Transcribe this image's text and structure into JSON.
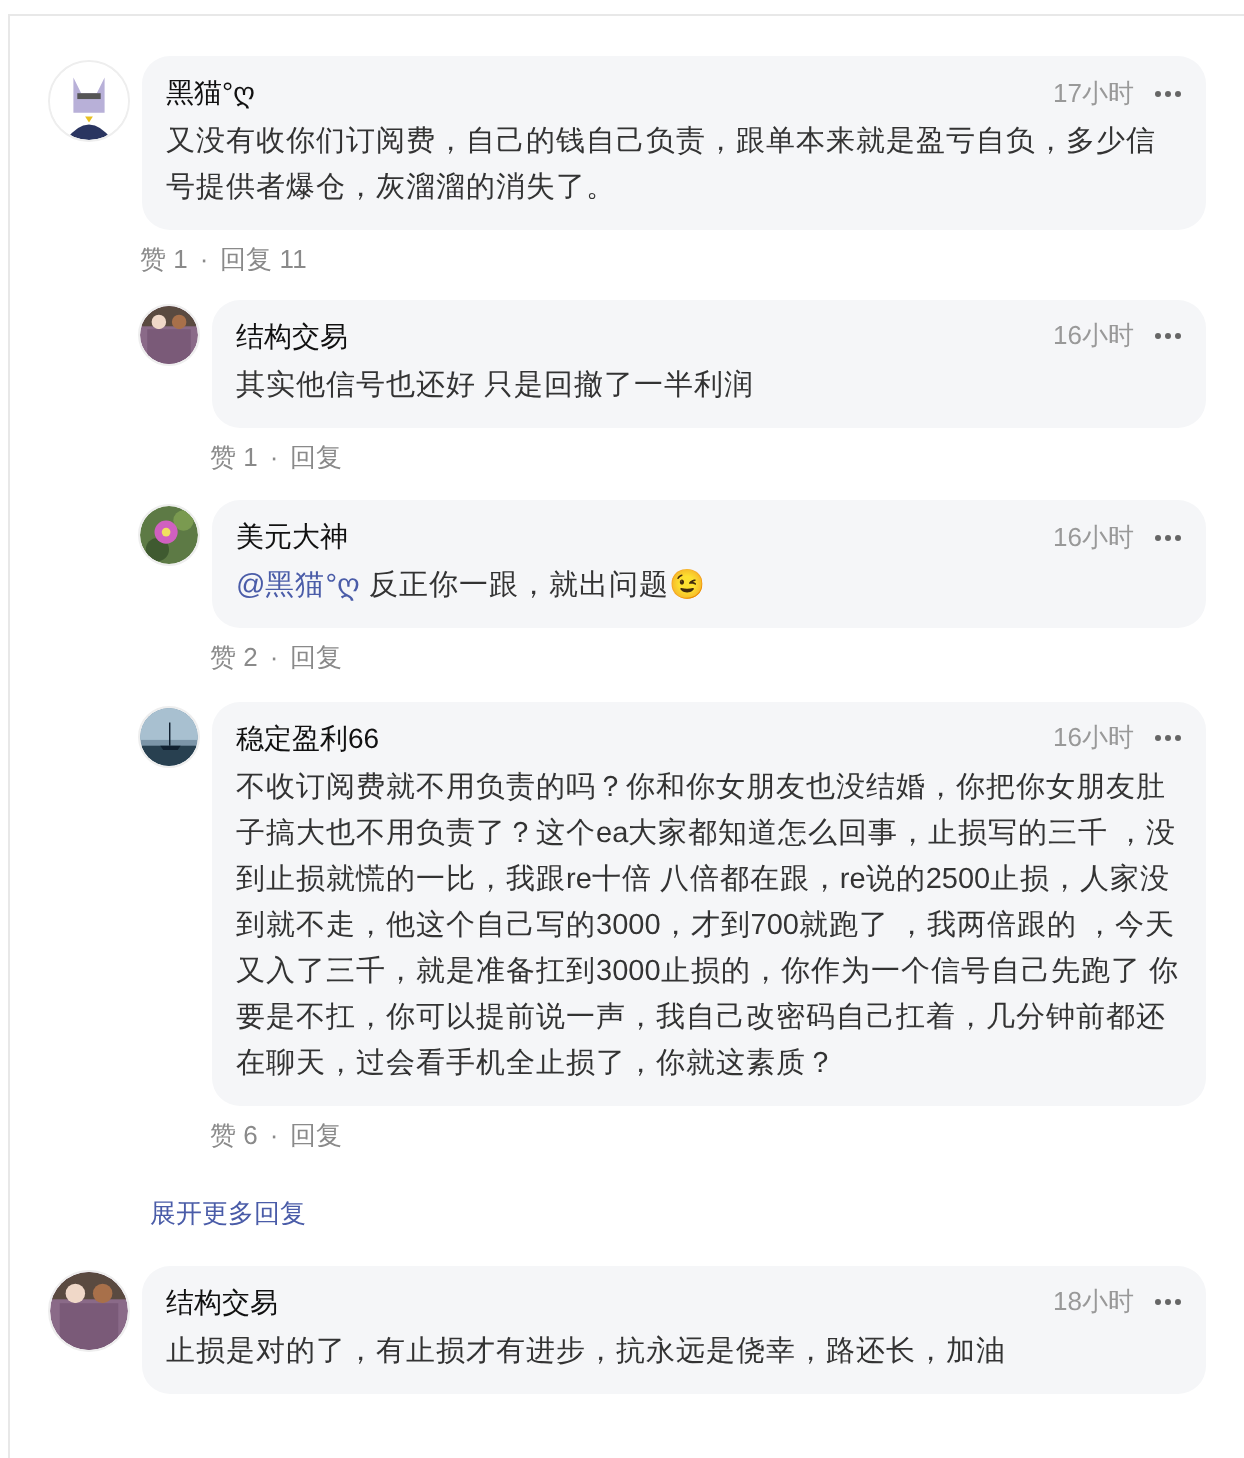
{
  "comments": [
    {
      "author": "黑猫°ღ",
      "time": "17小时",
      "text": "又没有收你们订阅费，自己的钱自己负责，跟单本来就是盈亏自负，多少信号提供者爆仓，灰溜溜的消失了。",
      "likes": "赞 1",
      "sep": "·",
      "reply": "回复 11",
      "replies": [
        {
          "author": "结构交易",
          "time": "16小时",
          "text": "其实他信号也还好 只是回撤了一半利润",
          "likes": "赞 1",
          "sep": "·",
          "reply": "回复"
        },
        {
          "author": "美元大神",
          "time": "16小时",
          "mention": "@黑猫°ღ",
          "text": "反正你一跟，就出问题😉",
          "likes": "赞 2",
          "sep": "·",
          "reply": "回复"
        },
        {
          "author": "稳定盈利66",
          "time": "16小时",
          "text": "不收订阅费就不用负责的吗？你和你女朋友也没结婚，你把你女朋友肚子搞大也不用负责了？这个ea大家都知道怎么回事，止损写的三千 ，没到止损就慌的一比，我跟re十倍 八倍都在跟，re说的2500止损，人家没到就不走，他这个自己写的3000，才到700就跑了 ，我两倍跟的 ，今天又入了三千，就是准备扛到3000止损的，你作为一个信号自己先跑了 你要是不扛，你可以提前说一声，我自己改密码自己扛着，几分钟前都还在聊天，过会看手机全止损了，你就这素质？",
          "likes": "赞 6",
          "sep": "·",
          "reply": "回复"
        }
      ],
      "more_replies": "展开更多回复"
    },
    {
      "author": "结构交易",
      "time": "18小时",
      "text": "止损是对的了，有止损才有进步，抗永远是侥幸，路还长，加油"
    }
  ]
}
